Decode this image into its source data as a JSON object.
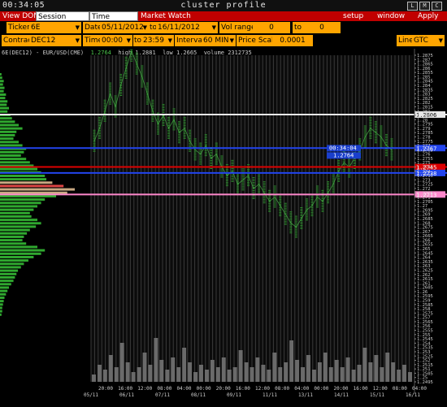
{
  "window": {
    "clock": "00:34:05",
    "title": "cluster profile",
    "buttons": [
      "L",
      "M",
      "C"
    ]
  },
  "menu": {
    "view_dom": "View DOM",
    "session_hours": "Session Hours",
    "time_interval": "Time Interval",
    "market_watch": "Market Watch",
    "setup": "setup",
    "window": "window",
    "apply": "Apply"
  },
  "toolbar": {
    "ticker_label": "Ticker",
    "ticker_value": "6E",
    "date_label": "Date",
    "date_from": "05/11/2012",
    "date_to_label": "to",
    "date_to": "16/11/2012",
    "vol_range_label": "Vol range",
    "vol_from": "0",
    "vol_to_label": "to",
    "vol_to": "0",
    "contract_label": "Contract",
    "contract_value": "DEC12",
    "time_label": "Time",
    "time_from": "00:00",
    "time_to_label": "to",
    "time_to": "23:59",
    "interval_label": "Interval",
    "interval_value": "60 MIN",
    "price_scale_label": "Price Scale",
    "price_scale_value": "0.0001",
    "line_label": "Line",
    "line_value": "GTC"
  },
  "chart_info": {
    "symbol": "6E(DEC12) - EUR/USD(CME)",
    "last": "1.2764",
    "high": "high 1.2881",
    "low": "low 1.2665",
    "volume": "volume 2312735"
  },
  "colors": {
    "menu_red": "#c00000",
    "toolbar_orange": "#ffa500",
    "profile_green": "#2fa82f",
    "price_green": "#4ec94e",
    "line_white": "#e8e8e8",
    "line_blue": "#2244ee",
    "line_red": "#dd0000",
    "line_pink": "#ff88cc"
  },
  "chart_data": {
    "type": "line",
    "y_ticks": [
      "1.2875",
      "1.287",
      "1.2865",
      "1.286",
      "1.2855",
      "1.285",
      "1.2845",
      "1.284",
      "1.2835",
      "1.283",
      "1.2825",
      "1.282",
      "1.2815",
      "1.281",
      "1.2805",
      "1.28",
      "1.2795",
      "1.279",
      "1.2785",
      "1.278",
      "1.2775",
      "1.277",
      "1.2765",
      "1.276",
      "1.2755",
      "1.275",
      "1.2745",
      "1.274",
      "1.2735",
      "1.273",
      "1.2725",
      "1.272",
      "1.2715",
      "1.271",
      "1.2705",
      "1.27",
      "1.2695",
      "1.269",
      "1.2685",
      "1.268",
      "1.2675",
      "1.267",
      "1.2665",
      "1.266",
      "1.2655",
      "1.265",
      "1.2645",
      "1.264",
      "1.2635",
      "1.263",
      "1.2625",
      "1.262",
      "1.2615",
      "1.261",
      "1.2605",
      "1.26",
      "1.2595",
      "1.259",
      "1.2585",
      "1.258",
      "1.2575",
      "1.257",
      "1.2565",
      "1.256",
      "1.2555",
      "1.255",
      "1.2545",
      "1.254",
      "1.2535",
      "1.253",
      "1.2525",
      "1.252",
      "1.2515",
      "1.251",
      "1.2505",
      "1.25",
      "1.2495"
    ],
    "ylim": [
      1.2495,
      1.2875
    ],
    "x_labels_top": [
      "20:00",
      "16:00",
      "12:00",
      "08:00",
      "04:00",
      "00:00",
      "20:00",
      "16:00",
      "12:00",
      "08:00",
      "04:00",
      "00:00",
      "20:00",
      "16:00",
      "12:00",
      "08:00",
      "04:00"
    ],
    "x_labels_bottom": [
      "05/11",
      "06/11",
      "07/11",
      "08/11",
      "09/11",
      "11/11",
      "13/11",
      "14/11",
      "15/11",
      "16/11"
    ],
    "price_lines": [
      {
        "price": "1.2806",
        "color": "#e8e8e8"
      },
      {
        "price": "1.2767",
        "color": "#2244ee"
      },
      {
        "price": "1.2745",
        "color": "#dd0000"
      },
      {
        "price": "1.2738",
        "color": "#2244ee"
      },
      {
        "price": "1.2713",
        "color": "#ff88cc"
      }
    ],
    "time_tag": "00:34:04",
    "last_price_tag": "1.2764",
    "close_prices": [
      1.2775,
      1.279,
      1.281,
      1.283,
      1.2815,
      1.284,
      1.286,
      1.288,
      1.2865,
      1.285,
      1.283,
      1.281,
      1.2795,
      1.2805,
      1.279,
      1.28,
      1.2785,
      1.279,
      1.2775,
      1.2765,
      1.276,
      1.277,
      1.2755,
      1.276,
      1.2745,
      1.2735,
      1.274,
      1.2725,
      1.273,
      1.2735,
      1.272,
      1.2725,
      1.2715,
      1.2705,
      1.271,
      1.27,
      1.269,
      1.268,
      1.2675,
      1.2685,
      1.2695,
      1.27,
      1.271,
      1.2705,
      1.2715,
      1.2725,
      1.274,
      1.275,
      1.2745,
      1.2755,
      1.2765,
      1.278,
      1.279,
      1.2785,
      1.278,
      1.277,
      1.2765
    ],
    "volume_heights": [
      0.15,
      0.35,
      0.25,
      0.55,
      0.3,
      0.8,
      0.4,
      0.2,
      0.3,
      0.6,
      0.35,
      0.9,
      0.45,
      0.25,
      0.5,
      0.3,
      0.7,
      0.4,
      0.2,
      0.35,
      0.25,
      0.45,
      0.3,
      0.5,
      0.25,
      0.3,
      0.65,
      0.4,
      0.3,
      0.5,
      0.35,
      0.25,
      0.6,
      0.3,
      0.4,
      0.85,
      0.45,
      0.3,
      0.55,
      0.25,
      0.4,
      0.6,
      0.3,
      0.45,
      0.3,
      0.5,
      0.25,
      0.35,
      0.7,
      0.4,
      0.55,
      0.3,
      0.6,
      0.4,
      0.25,
      0.35,
      0.2
    ],
    "profile_volumes": [
      0.02,
      0.03,
      0.05,
      0.04,
      0.06,
      0.05,
      0.08,
      0.07,
      0.1,
      0.09,
      0.12,
      0.1,
      0.14,
      0.16,
      0.2,
      0.25,
      0.3,
      0.22,
      0.2,
      0.18,
      0.25,
      0.3,
      0.35,
      0.32,
      0.28,
      0.35,
      0.4,
      0.45,
      0.5,
      0.55,
      0.6,
      0.62,
      0.7,
      0.85,
      1.0,
      0.9,
      0.75,
      0.6,
      0.55,
      0.5,
      0.45,
      0.4,
      0.42,
      0.5,
      0.55,
      0.48,
      0.4,
      0.36,
      0.32,
      0.3,
      0.35,
      0.5,
      0.6,
      0.55,
      0.45,
      0.38,
      0.32,
      0.28,
      0.24,
      0.22,
      0.2,
      0.18,
      0.15,
      0.12,
      0.1,
      0.08,
      0.06,
      0.05,
      0.04,
      0.03,
      0.03,
      0.02
    ]
  }
}
